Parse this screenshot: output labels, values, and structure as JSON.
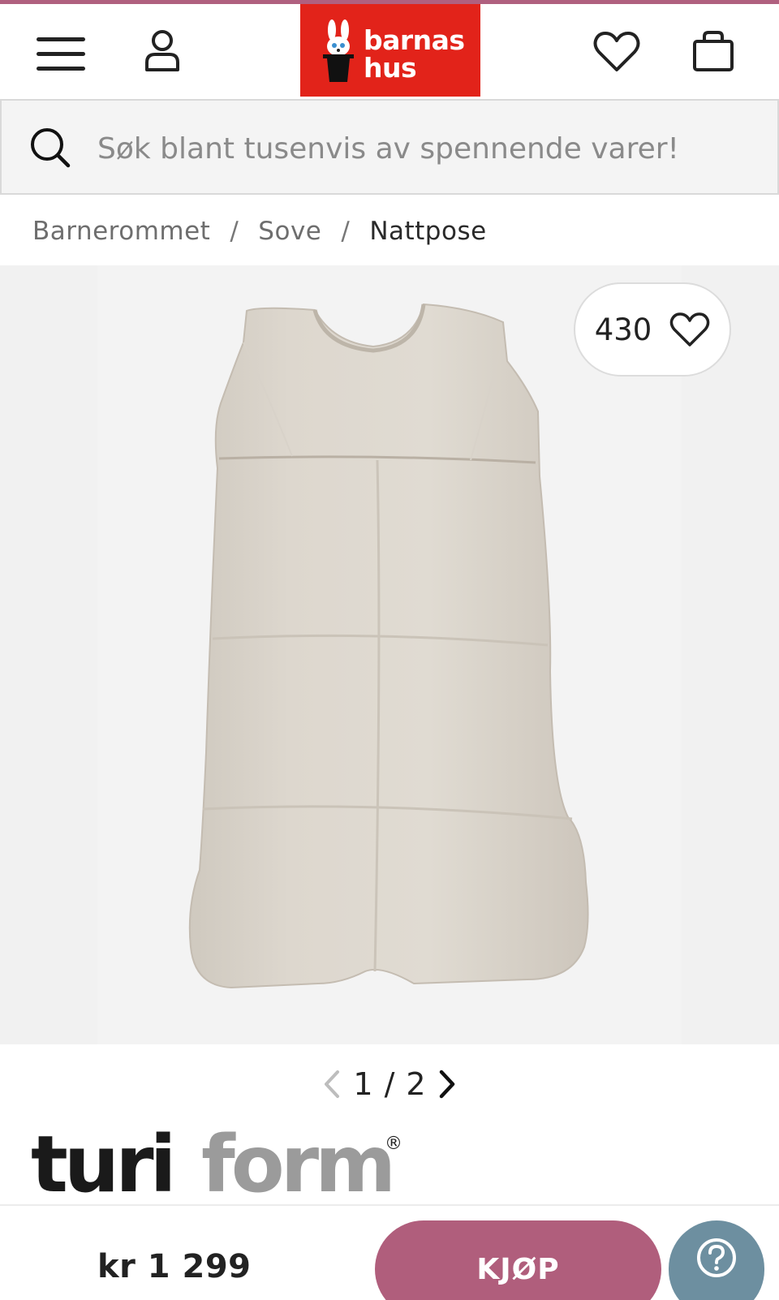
{
  "header": {
    "menu_icon": "hamburger-menu-icon",
    "account_icon": "user-icon",
    "logo_text_line1": "barnas",
    "logo_text_line2": "hus",
    "wishlist_icon": "heart-icon",
    "cart_icon": "shopping-bag-icon",
    "accent_color": "#e2231a"
  },
  "search": {
    "placeholder": "Søk blant tusenvis av spennende varer!"
  },
  "breadcrumb": {
    "items": [
      "Barnerommet",
      "Sove",
      "Nattpose"
    ],
    "separator": "/"
  },
  "product": {
    "likes": "430",
    "gallery": {
      "current": "1",
      "separator": "/",
      "total": "2"
    },
    "brand": "turiform",
    "brand_part_dark": "turi",
    "brand_part_light": "form",
    "registered_mark": "®"
  },
  "footer_bar": {
    "price": "kr 1 299",
    "buy_label": "KJØP",
    "buy_color": "#b05e7c",
    "help_icon": "question-mark-icon",
    "help_color": "#6d8fa0"
  }
}
